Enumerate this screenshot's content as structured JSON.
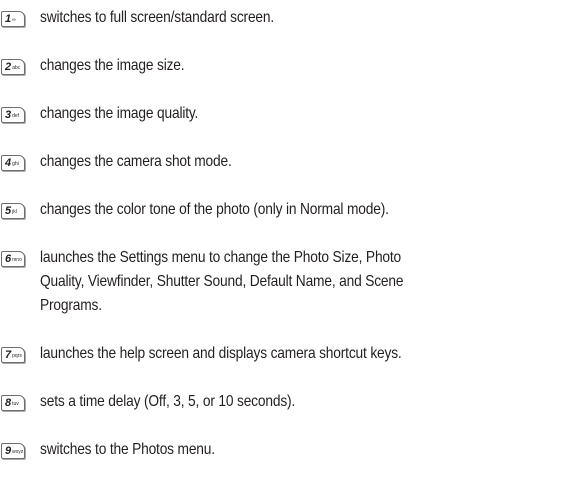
{
  "shortcuts": [
    {
      "key": "1",
      "key_sub": "∞",
      "description": "switches to full screen/standard screen."
    },
    {
      "key": "2",
      "key_sub": "abc",
      "description": "changes the image size."
    },
    {
      "key": "3",
      "key_sub": "def",
      "description": "changes the image quality."
    },
    {
      "key": "4",
      "key_sub": "ghi",
      "description": "changes the camera shot mode."
    },
    {
      "key": "5",
      "key_sub": "jkl",
      "description": "changes the color tone of the photo (only in Normal mode)."
    },
    {
      "key": "6",
      "key_sub": "mno",
      "description_lines": [
        "launches the Settings menu to change the Photo Size, Photo",
        "Quality, Viewfinder, Shutter Sound, Default Name, and Scene",
        "Programs."
      ]
    },
    {
      "key": "7",
      "key_sub": "pqrs",
      "description": "launches the help screen and displays camera shortcut keys."
    },
    {
      "key": "8",
      "key_sub": "tuv",
      "description": "sets a time delay (Off, 3, 5, or 10 seconds)."
    },
    {
      "key": "9",
      "key_sub": "wxyz",
      "description": "switches to the Photos menu."
    }
  ]
}
